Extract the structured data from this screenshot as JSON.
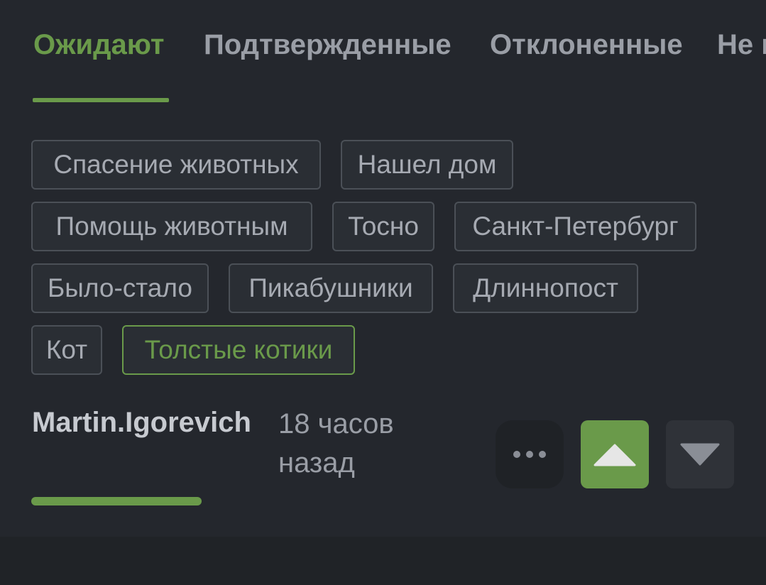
{
  "tabs": [
    {
      "label": "Ожидают"
    },
    {
      "label": "Подтвержденные"
    },
    {
      "label": "Отклоненные"
    },
    {
      "label": "Не и"
    }
  ],
  "tags": [
    {
      "label": "Спасение животных"
    },
    {
      "label": "Нашел дом"
    },
    {
      "label": "Помощь животным"
    },
    {
      "label": "Тосно"
    },
    {
      "label": "Санкт-Петербург"
    },
    {
      "label": "Было-стало"
    },
    {
      "label": "Пикабушники"
    },
    {
      "label": "Длиннопост"
    },
    {
      "label": "Кот"
    },
    {
      "label": "Толстые котики"
    }
  ],
  "post": {
    "author": "Martin.Igorevich",
    "time_line1": "18 часов",
    "time_line2": "назад"
  },
  "colors": {
    "accent": "#6a9a4a",
    "background": "#24272d"
  }
}
